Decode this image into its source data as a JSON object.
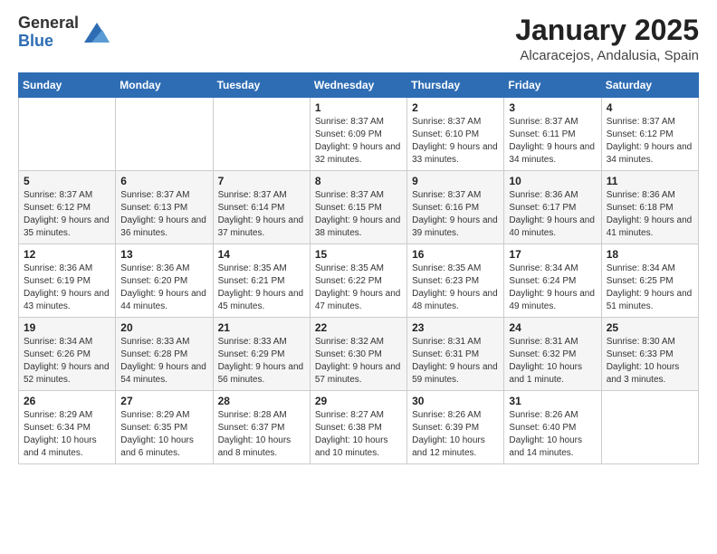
{
  "logo": {
    "general": "General",
    "blue": "Blue"
  },
  "title": "January 2025",
  "subtitle": "Alcaracejos, Andalusia, Spain",
  "days_of_week": [
    "Sunday",
    "Monday",
    "Tuesday",
    "Wednesday",
    "Thursday",
    "Friday",
    "Saturday"
  ],
  "weeks": [
    [
      {
        "day": "",
        "info": ""
      },
      {
        "day": "",
        "info": ""
      },
      {
        "day": "",
        "info": ""
      },
      {
        "day": "1",
        "info": "Sunrise: 8:37 AM\nSunset: 6:09 PM\nDaylight: 9 hours\nand 32 minutes."
      },
      {
        "day": "2",
        "info": "Sunrise: 8:37 AM\nSunset: 6:10 PM\nDaylight: 9 hours\nand 33 minutes."
      },
      {
        "day": "3",
        "info": "Sunrise: 8:37 AM\nSunset: 6:11 PM\nDaylight: 9 hours\nand 34 minutes."
      },
      {
        "day": "4",
        "info": "Sunrise: 8:37 AM\nSunset: 6:12 PM\nDaylight: 9 hours\nand 34 minutes."
      }
    ],
    [
      {
        "day": "5",
        "info": "Sunrise: 8:37 AM\nSunset: 6:12 PM\nDaylight: 9 hours\nand 35 minutes."
      },
      {
        "day": "6",
        "info": "Sunrise: 8:37 AM\nSunset: 6:13 PM\nDaylight: 9 hours\nand 36 minutes."
      },
      {
        "day": "7",
        "info": "Sunrise: 8:37 AM\nSunset: 6:14 PM\nDaylight: 9 hours\nand 37 minutes."
      },
      {
        "day": "8",
        "info": "Sunrise: 8:37 AM\nSunset: 6:15 PM\nDaylight: 9 hours\nand 38 minutes."
      },
      {
        "day": "9",
        "info": "Sunrise: 8:37 AM\nSunset: 6:16 PM\nDaylight: 9 hours\nand 39 minutes."
      },
      {
        "day": "10",
        "info": "Sunrise: 8:36 AM\nSunset: 6:17 PM\nDaylight: 9 hours\nand 40 minutes."
      },
      {
        "day": "11",
        "info": "Sunrise: 8:36 AM\nSunset: 6:18 PM\nDaylight: 9 hours\nand 41 minutes."
      }
    ],
    [
      {
        "day": "12",
        "info": "Sunrise: 8:36 AM\nSunset: 6:19 PM\nDaylight: 9 hours\nand 43 minutes."
      },
      {
        "day": "13",
        "info": "Sunrise: 8:36 AM\nSunset: 6:20 PM\nDaylight: 9 hours\nand 44 minutes."
      },
      {
        "day": "14",
        "info": "Sunrise: 8:35 AM\nSunset: 6:21 PM\nDaylight: 9 hours\nand 45 minutes."
      },
      {
        "day": "15",
        "info": "Sunrise: 8:35 AM\nSunset: 6:22 PM\nDaylight: 9 hours\nand 47 minutes."
      },
      {
        "day": "16",
        "info": "Sunrise: 8:35 AM\nSunset: 6:23 PM\nDaylight: 9 hours\nand 48 minutes."
      },
      {
        "day": "17",
        "info": "Sunrise: 8:34 AM\nSunset: 6:24 PM\nDaylight: 9 hours\nand 49 minutes."
      },
      {
        "day": "18",
        "info": "Sunrise: 8:34 AM\nSunset: 6:25 PM\nDaylight: 9 hours\nand 51 minutes."
      }
    ],
    [
      {
        "day": "19",
        "info": "Sunrise: 8:34 AM\nSunset: 6:26 PM\nDaylight: 9 hours\nand 52 minutes."
      },
      {
        "day": "20",
        "info": "Sunrise: 8:33 AM\nSunset: 6:28 PM\nDaylight: 9 hours\nand 54 minutes."
      },
      {
        "day": "21",
        "info": "Sunrise: 8:33 AM\nSunset: 6:29 PM\nDaylight: 9 hours\nand 56 minutes."
      },
      {
        "day": "22",
        "info": "Sunrise: 8:32 AM\nSunset: 6:30 PM\nDaylight: 9 hours\nand 57 minutes."
      },
      {
        "day": "23",
        "info": "Sunrise: 8:31 AM\nSunset: 6:31 PM\nDaylight: 9 hours\nand 59 minutes."
      },
      {
        "day": "24",
        "info": "Sunrise: 8:31 AM\nSunset: 6:32 PM\nDaylight: 10 hours\nand 1 minute."
      },
      {
        "day": "25",
        "info": "Sunrise: 8:30 AM\nSunset: 6:33 PM\nDaylight: 10 hours\nand 3 minutes."
      }
    ],
    [
      {
        "day": "26",
        "info": "Sunrise: 8:29 AM\nSunset: 6:34 PM\nDaylight: 10 hours\nand 4 minutes."
      },
      {
        "day": "27",
        "info": "Sunrise: 8:29 AM\nSunset: 6:35 PM\nDaylight: 10 hours\nand 6 minutes."
      },
      {
        "day": "28",
        "info": "Sunrise: 8:28 AM\nSunset: 6:37 PM\nDaylight: 10 hours\nand 8 minutes."
      },
      {
        "day": "29",
        "info": "Sunrise: 8:27 AM\nSunset: 6:38 PM\nDaylight: 10 hours\nand 10 minutes."
      },
      {
        "day": "30",
        "info": "Sunrise: 8:26 AM\nSunset: 6:39 PM\nDaylight: 10 hours\nand 12 minutes."
      },
      {
        "day": "31",
        "info": "Sunrise: 8:26 AM\nSunset: 6:40 PM\nDaylight: 10 hours\nand 14 minutes."
      },
      {
        "day": "",
        "info": ""
      }
    ]
  ]
}
